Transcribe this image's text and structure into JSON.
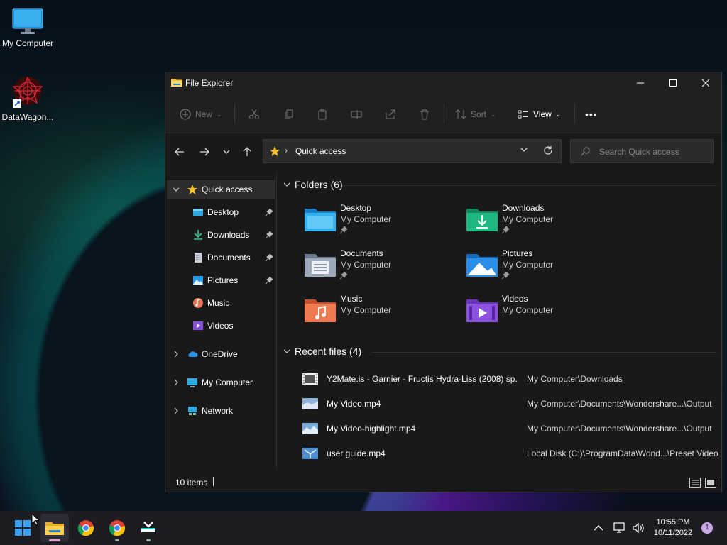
{
  "desktop": {
    "icons": [
      {
        "label": "My Computer",
        "icon": "monitor-icon"
      },
      {
        "label": "DataWagon...",
        "icon": "datawagon-shortcut-icon"
      }
    ]
  },
  "window": {
    "title": "File Explorer",
    "controls": {
      "minimize": "minimize-icon",
      "maximize": "maximize-icon",
      "close": "close-icon"
    }
  },
  "toolbar": {
    "new_label": "New",
    "sort_label": "Sort",
    "view_label": "View",
    "more_label": "•••"
  },
  "address": {
    "location": "Quick access",
    "search_placeholder": "Search Quick access"
  },
  "sidebar": {
    "items": [
      {
        "label": "Quick access",
        "icon": "star-icon",
        "pinned": false
      },
      {
        "label": "Desktop",
        "icon": "desktop-folder-icon",
        "pinned": true
      },
      {
        "label": "Downloads",
        "icon": "download-icon",
        "pinned": true
      },
      {
        "label": "Documents",
        "icon": "document-icon",
        "pinned": true
      },
      {
        "label": "Pictures",
        "icon": "pictures-icon",
        "pinned": true
      },
      {
        "label": "Music",
        "icon": "music-icon",
        "pinned": false
      },
      {
        "label": "Videos",
        "icon": "videos-icon",
        "pinned": false
      },
      {
        "label": "OneDrive",
        "icon": "cloud-icon",
        "pinned": false
      },
      {
        "label": "My Computer",
        "icon": "computer-icon",
        "pinned": false
      },
      {
        "label": "Network",
        "icon": "network-icon",
        "pinned": false
      }
    ]
  },
  "folders": {
    "heading": "Folders (6)",
    "items": [
      {
        "name": "Desktop",
        "location": "My Computer",
        "pinned": true,
        "icon": "desktop-folder-icon"
      },
      {
        "name": "Downloads",
        "location": "My Computer",
        "pinned": true,
        "icon": "downloads-folder-icon"
      },
      {
        "name": "Documents",
        "location": "My Computer",
        "pinned": true,
        "icon": "documents-folder-icon"
      },
      {
        "name": "Pictures",
        "location": "My Computer",
        "pinned": true,
        "icon": "pictures-folder-icon"
      },
      {
        "name": "Music",
        "location": "My Computer",
        "pinned": false,
        "icon": "music-folder-icon"
      },
      {
        "name": "Videos",
        "location": "My Computer",
        "pinned": false,
        "icon": "videos-folder-icon"
      }
    ]
  },
  "recent": {
    "heading": "Recent files (4)",
    "items": [
      {
        "name": "Y2Mate.is - Garnier - Fructis Hydra-Liss (2008) sp...",
        "path": "My Computer\\Downloads"
      },
      {
        "name": "My Video.mp4",
        "path": "My Computer\\Documents\\Wondershare...\\Output"
      },
      {
        "name": "My Video-highlight.mp4",
        "path": "My Computer\\Documents\\Wondershare...\\Output"
      },
      {
        "name": "user guide.mp4",
        "path": "Local Disk (C:)\\ProgramData\\Wond...\\Preset Video"
      }
    ]
  },
  "status": {
    "item_count": "10 items"
  },
  "taskbar": {
    "apps": [
      "start-icon",
      "file-explorer-icon",
      "chrome-icon",
      "chrome-icon",
      "filmora-icon"
    ],
    "time": "10:55 PM",
    "date": "10/11/2022",
    "notifications": "1"
  },
  "colors": {
    "window_bg": "#191919",
    "titlebar_bg": "#202020",
    "selected_bg": "#2d2d2d",
    "accent": "#0078d4"
  }
}
